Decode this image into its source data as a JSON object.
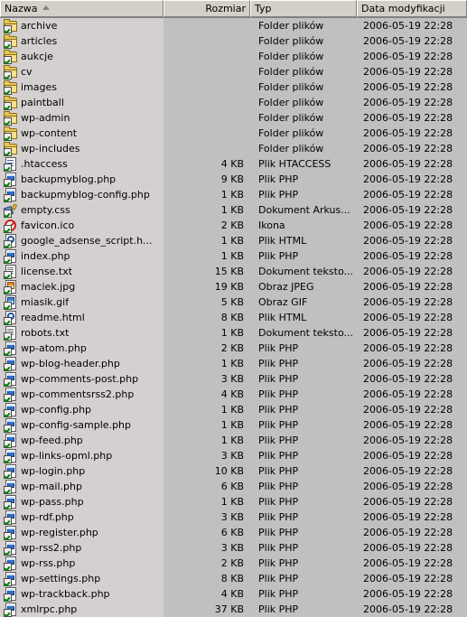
{
  "columns": [
    {
      "key": "name",
      "label": "Nazwa",
      "sort": "asc",
      "align": "left"
    },
    {
      "key": "size",
      "label": "Rozmiar",
      "sort": "none",
      "align": "right"
    },
    {
      "key": "type",
      "label": "Typ",
      "sort": "none",
      "align": "left"
    },
    {
      "key": "date",
      "label": "Data modyfikacji",
      "sort": "none",
      "align": "left"
    }
  ],
  "colors": {
    "window_background": "#c0c0c0",
    "header_face": "#d4d0c8",
    "name_column_band": "#d4d0cf",
    "text": "#000000",
    "folder_yellow": "#e8c85a",
    "check_green": "#008000",
    "link_blue": "#2b6fd4",
    "deny_red": "#cc1f1f"
  },
  "rows": [
    {
      "icon": "folder-icon",
      "name": "archive",
      "size": "",
      "type": "Folder plików",
      "date": "2006-05-19 22:28"
    },
    {
      "icon": "folder-icon",
      "name": "articles",
      "size": "",
      "type": "Folder plików",
      "date": "2006-05-19 22:28"
    },
    {
      "icon": "folder-icon",
      "name": "aukcje",
      "size": "",
      "type": "Folder plików",
      "date": "2006-05-19 22:28"
    },
    {
      "icon": "folder-icon",
      "name": "cv",
      "size": "",
      "type": "Folder plików",
      "date": "2006-05-19 22:28"
    },
    {
      "icon": "folder-icon",
      "name": "images",
      "size": "",
      "type": "Folder plików",
      "date": "2006-05-19 22:28"
    },
    {
      "icon": "folder-icon",
      "name": "paintball",
      "size": "",
      "type": "Folder plików",
      "date": "2006-05-19 22:28"
    },
    {
      "icon": "folder-icon",
      "name": "wp-admin",
      "size": "",
      "type": "Folder plików",
      "date": "2006-05-19 22:28"
    },
    {
      "icon": "folder-icon",
      "name": "wp-content",
      "size": "",
      "type": "Folder plików",
      "date": "2006-05-19 22:28"
    },
    {
      "icon": "folder-icon",
      "name": "wp-includes",
      "size": "",
      "type": "Folder plików",
      "date": "2006-05-19 22:28"
    },
    {
      "icon": "htaccess-file-icon",
      "name": ".htaccess",
      "size": "4 KB",
      "type": "Plik HTACCESS",
      "date": "2006-05-19 22:28"
    },
    {
      "icon": "php-file-icon",
      "name": "backupmyblog.php",
      "size": "9 KB",
      "type": "Plik PHP",
      "date": "2006-05-19 22:28"
    },
    {
      "icon": "php-file-icon",
      "name": "backupmyblog-config.php",
      "size": "1 KB",
      "type": "Plik PHP",
      "date": "2006-05-19 22:28"
    },
    {
      "icon": "css-file-icon",
      "name": "empty.css",
      "size": "1 KB",
      "type": "Dokument Arkus...",
      "date": "2006-05-19 22:28"
    },
    {
      "icon": "ico-file-icon",
      "name": "favicon.ico",
      "size": "2 KB",
      "type": "Ikona",
      "date": "2006-05-19 22:28"
    },
    {
      "icon": "html-file-icon",
      "name": "google_adsense_script.h...",
      "size": "1 KB",
      "type": "Plik HTML",
      "date": "2006-05-19 22:28"
    },
    {
      "icon": "php-file-icon",
      "name": "index.php",
      "size": "1 KB",
      "type": "Plik PHP",
      "date": "2006-05-19 22:28"
    },
    {
      "icon": "txt-file-icon",
      "name": "license.txt",
      "size": "15 KB",
      "type": "Dokument teksto...",
      "date": "2006-05-19 22:28"
    },
    {
      "icon": "jpeg-file-icon",
      "name": "maciek.jpg",
      "size": "19 KB",
      "type": "Obraz JPEG",
      "date": "2006-05-19 22:28"
    },
    {
      "icon": "gif-file-icon",
      "name": "miasik.gif",
      "size": "5 KB",
      "type": "Obraz GIF",
      "date": "2006-05-19 22:28"
    },
    {
      "icon": "html-file-icon",
      "name": "readme.html",
      "size": "8 KB",
      "type": "Plik HTML",
      "date": "2006-05-19 22:28"
    },
    {
      "icon": "txt-file-icon",
      "name": "robots.txt",
      "size": "1 KB",
      "type": "Dokument teksto...",
      "date": "2006-05-19 22:28"
    },
    {
      "icon": "php-file-icon",
      "name": "wp-atom.php",
      "size": "2 KB",
      "type": "Plik PHP",
      "date": "2006-05-19 22:28"
    },
    {
      "icon": "php-file-icon",
      "name": "wp-blog-header.php",
      "size": "1 KB",
      "type": "Plik PHP",
      "date": "2006-05-19 22:28"
    },
    {
      "icon": "php-file-icon",
      "name": "wp-comments-post.php",
      "size": "3 KB",
      "type": "Plik PHP",
      "date": "2006-05-19 22:28"
    },
    {
      "icon": "php-file-icon",
      "name": "wp-commentsrss2.php",
      "size": "4 KB",
      "type": "Plik PHP",
      "date": "2006-05-19 22:28"
    },
    {
      "icon": "php-file-icon",
      "name": "wp-config.php",
      "size": "1 KB",
      "type": "Plik PHP",
      "date": "2006-05-19 22:28"
    },
    {
      "icon": "php-file-icon",
      "name": "wp-config-sample.php",
      "size": "1 KB",
      "type": "Plik PHP",
      "date": "2006-05-19 22:28"
    },
    {
      "icon": "php-file-icon",
      "name": "wp-feed.php",
      "size": "1 KB",
      "type": "Plik PHP",
      "date": "2006-05-19 22:28"
    },
    {
      "icon": "php-file-icon",
      "name": "wp-links-opml.php",
      "size": "3 KB",
      "type": "Plik PHP",
      "date": "2006-05-19 22:28"
    },
    {
      "icon": "php-file-icon",
      "name": "wp-login.php",
      "size": "10 KB",
      "type": "Plik PHP",
      "date": "2006-05-19 22:28"
    },
    {
      "icon": "php-file-icon",
      "name": "wp-mail.php",
      "size": "6 KB",
      "type": "Plik PHP",
      "date": "2006-05-19 22:28"
    },
    {
      "icon": "php-file-icon",
      "name": "wp-pass.php",
      "size": "1 KB",
      "type": "Plik PHP",
      "date": "2006-05-19 22:28"
    },
    {
      "icon": "php-file-icon",
      "name": "wp-rdf.php",
      "size": "3 KB",
      "type": "Plik PHP",
      "date": "2006-05-19 22:28"
    },
    {
      "icon": "php-file-icon",
      "name": "wp-register.php",
      "size": "6 KB",
      "type": "Plik PHP",
      "date": "2006-05-19 22:28"
    },
    {
      "icon": "php-file-icon",
      "name": "wp-rss2.php",
      "size": "3 KB",
      "type": "Plik PHP",
      "date": "2006-05-19 22:28"
    },
    {
      "icon": "php-file-icon",
      "name": "wp-rss.php",
      "size": "2 KB",
      "type": "Plik PHP",
      "date": "2006-05-19 22:28"
    },
    {
      "icon": "php-file-icon",
      "name": "wp-settings.php",
      "size": "8 KB",
      "type": "Plik PHP",
      "date": "2006-05-19 22:28"
    },
    {
      "icon": "php-file-icon",
      "name": "wp-trackback.php",
      "size": "4 KB",
      "type": "Plik PHP",
      "date": "2006-05-19 22:28"
    },
    {
      "icon": "php-file-icon",
      "name": "xmlrpc.php",
      "size": "37 KB",
      "type": "Plik PHP",
      "date": "2006-05-19 22:28"
    }
  ]
}
